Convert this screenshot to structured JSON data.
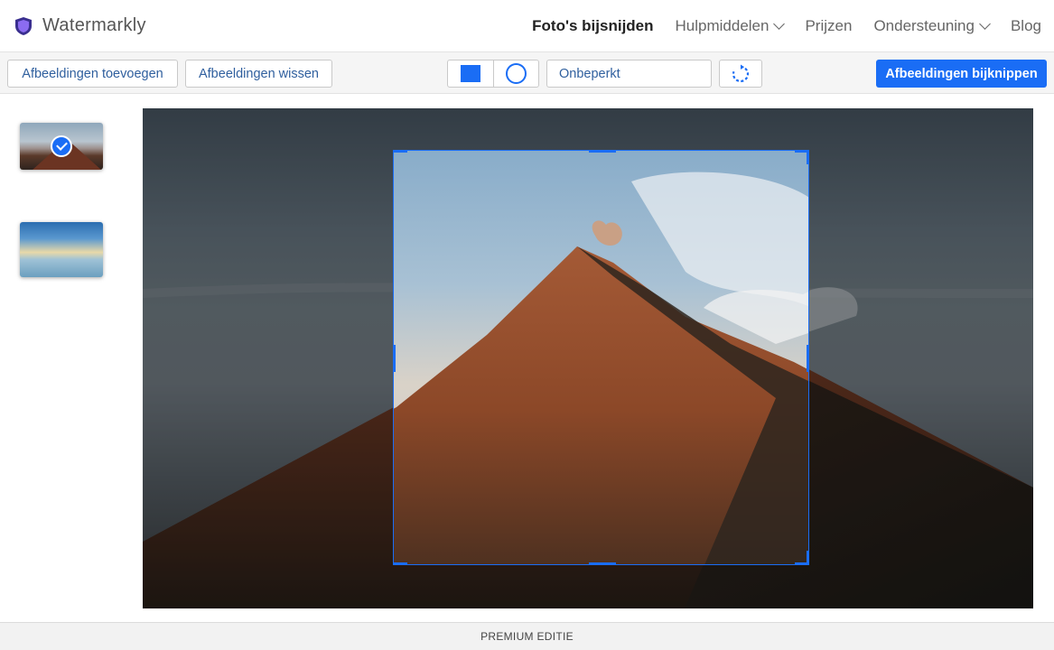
{
  "header": {
    "brand": "Watermarkly",
    "nav": [
      {
        "label": "Foto's bijsnijden",
        "active": true,
        "dropdown": false
      },
      {
        "label": "Hulpmiddelen",
        "active": false,
        "dropdown": true
      },
      {
        "label": "Prijzen",
        "active": false,
        "dropdown": false
      },
      {
        "label": "Ondersteuning",
        "active": false,
        "dropdown": true
      },
      {
        "label": "Blog",
        "active": false,
        "dropdown": false
      }
    ]
  },
  "toolbar": {
    "add_label": "Afbeeldingen toevoegen",
    "clear_label": "Afbeeldingen wissen",
    "shape_options": [
      "square",
      "circle"
    ],
    "selected_shape": "square",
    "aspect_ratio": "Onbeperkt",
    "crop_label": "Afbeeldingen bijknippen"
  },
  "sidebar": {
    "thumbnails": [
      {
        "subject": "volcano",
        "selected": true
      },
      {
        "subject": "seascape",
        "selected": false
      }
    ]
  },
  "editor": {
    "image_subject": "volcano at sunrise"
  },
  "footer": {
    "edition": "PREMIUM EDITIE"
  },
  "colors": {
    "accent": "#1a6df5",
    "link_text": "#2f5f9e"
  }
}
